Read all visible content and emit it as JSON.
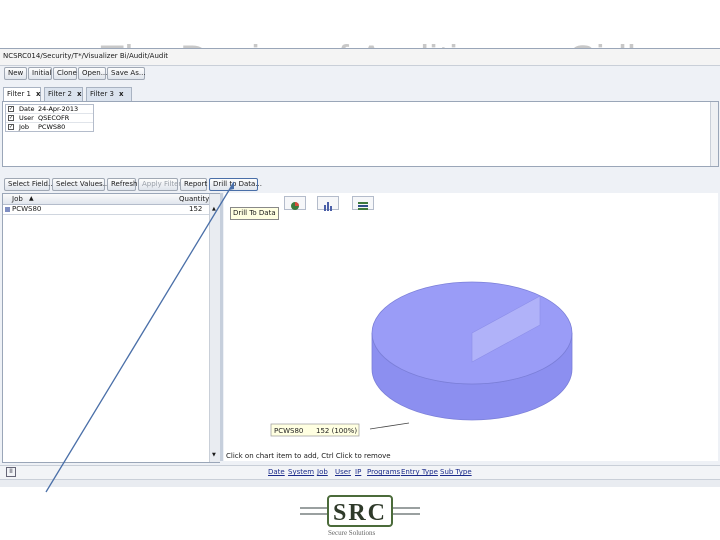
{
  "slide": {
    "title": "The Design of Auditing on Sidle"
  },
  "window": {
    "title": "NCSRC014/Security/T*/Visualizer Bi/Audit/Audit"
  },
  "toolbar_main": {
    "new": "New",
    "initial": "Initial",
    "clone": "Clone",
    "open": "Open...",
    "save_as": "Save As..."
  },
  "filter_tabs": [
    {
      "label": "Filter 1",
      "close": "x",
      "active": true
    },
    {
      "label": "Filter 2",
      "close": "x",
      "active": false
    },
    {
      "label": "Filter 3",
      "close": "x",
      "active": false
    }
  ],
  "filters": [
    {
      "checked": true,
      "name": "Date",
      "value": "24-Apr-2013"
    },
    {
      "checked": true,
      "name": "User",
      "value": "QSECOFR"
    },
    {
      "checked": true,
      "name": "Job",
      "value": "PCWS80"
    }
  ],
  "toolbar_second": {
    "select_fields": "Select Field...",
    "select_values": "Select Values...",
    "refresh": "Refresh",
    "apply_filter": "Apply Filter",
    "report": "Report",
    "drill_to_data": "Drill to Data..."
  },
  "grid": {
    "columns": {
      "job": "Job",
      "quantity": "Quantity"
    },
    "rows": [
      {
        "job": "PCWS80",
        "quantity": "152"
      }
    ]
  },
  "chart_tooltip": "Drill To Data",
  "chart_data": {
    "type": "pie",
    "categories": [
      "PCWS80"
    ],
    "values": [
      152
    ],
    "label": "PCWS80",
    "value_label": "152 (100%)",
    "color": "#9a9cf7"
  },
  "chart_hint": "Click on chart item to add, Ctrl Click to remove",
  "panel_toggle": "II",
  "status_links": [
    "Date",
    "System",
    "Job",
    "User",
    "IP",
    "Programs",
    "Entry Type",
    "Sub Type"
  ],
  "logo": {
    "text": "SRC",
    "tagline": "Secure Solutions"
  },
  "colors": {
    "accent": "#2f4f8a",
    "logo_green": "#4b6b3a",
    "pie": "#9a9cf7"
  }
}
